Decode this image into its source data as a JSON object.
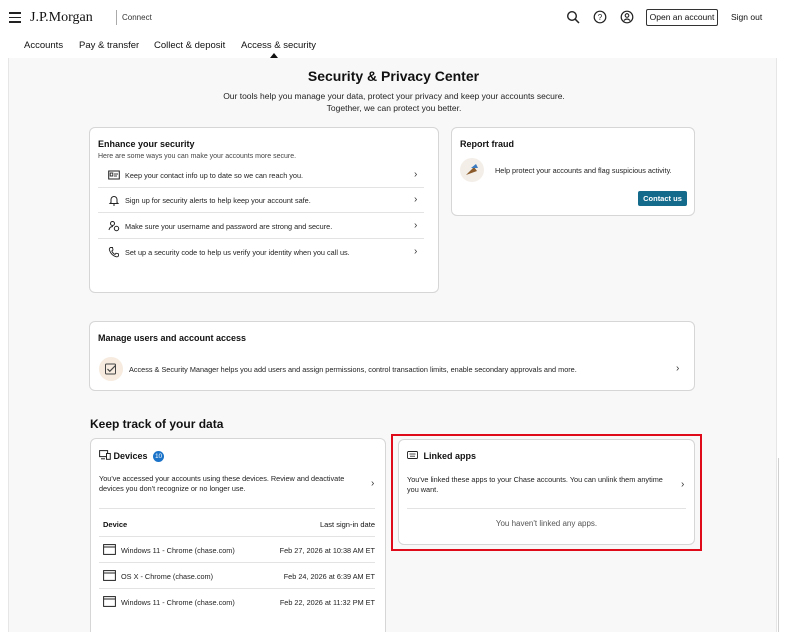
{
  "header": {
    "brand": "J.P.Morgan",
    "brand_sub": "Connect",
    "open_account": "Open an account",
    "sign_out": "Sign out",
    "icons": [
      "menu-icon",
      "search-icon",
      "help-icon",
      "profile-icon"
    ]
  },
  "nav": {
    "items": [
      "Accounts",
      "Pay & transfer",
      "Collect & deposit",
      "Access & security"
    ],
    "active": "Access & security"
  },
  "page": {
    "title": "Security & Privacy Center",
    "description": "Our tools help you manage your data, protect your privacy and keep your accounts secure. Together, we can protect you better."
  },
  "enhance": {
    "title": "Enhance your security",
    "subtitle": "Here are some ways you can make your accounts more secure.",
    "items": [
      {
        "icon": "contact-card-icon",
        "label": "Keep your contact info up to date so we can reach you."
      },
      {
        "icon": "bell-icon",
        "label": "Sign up for security alerts to help keep your account safe."
      },
      {
        "icon": "user-key-icon",
        "label": "Make sure your username and password are strong and secure."
      },
      {
        "icon": "phone-icon",
        "label": "Set up a security code to help us verify your identity when you call us."
      }
    ]
  },
  "fraud": {
    "title": "Report fraud",
    "text": "Help protect your accounts and flag suspicious activity.",
    "button": "Contact us"
  },
  "manage": {
    "title": "Manage users and account access",
    "text": "Access & Security Manager helps you add users and assign permissions, control transaction limits, enable secondary approvals and more."
  },
  "track": {
    "title": "Keep track of your data"
  },
  "devices": {
    "title": "Devices",
    "count": "10",
    "text": "You've accessed your accounts using these devices. Review and deactivate devices you don't recognize or no longer use.",
    "col_device": "Device",
    "col_date": "Last sign-in date",
    "rows": [
      {
        "name": "Windows 11 - Chrome (chase.com)",
        "date": "Feb 27, 2026 at 10:38 AM ET"
      },
      {
        "name": "OS X - Chrome (chase.com)",
        "date": "Feb 24, 2026 at 6:39 AM ET"
      },
      {
        "name": "Windows 11 - Chrome (chase.com)",
        "date": "Feb 22, 2026 at 11:32 PM ET"
      }
    ]
  },
  "linked": {
    "title": "Linked apps",
    "text": "You've linked these apps to your Chase accounts. You can unlink them anytime you want.",
    "empty": "You haven't linked any apps."
  },
  "colors": {
    "accent": "#136a8b",
    "badge": "#1a73c8",
    "highlight": "#e00b1a"
  }
}
